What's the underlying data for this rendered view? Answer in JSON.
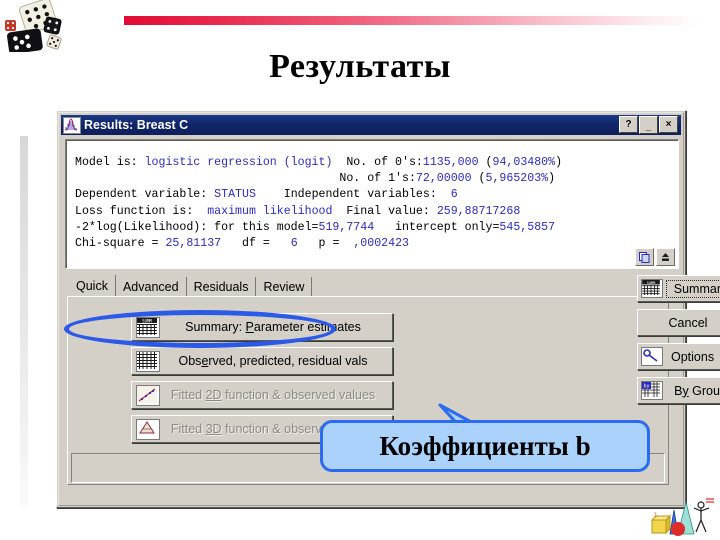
{
  "slide": {
    "title": "Результаты"
  },
  "decor": {
    "logo_icon": "dice-logo",
    "bar_color_start": "#e00b33",
    "bar_color_end": "#ffffff",
    "corner_icon": "geometry-shapes-clipart"
  },
  "dialog": {
    "titlebar": {
      "icon": "distribution-curve-icon",
      "title": "Results: Breast C",
      "help_label": "?",
      "minimize_label": "_",
      "close_label": "×"
    },
    "output": {
      "lines": [
        "Model is: logistic regression (logit)  No. of 0's:1135,000 (94,03480%)",
        "                                      No. of 1's:72,00000 (5,965203%)",
        "Dependent variable: STATUS    Independent variables:  6",
        "Loss function is:  maximum likelihood  Final value: 259,88717268",
        "-2*log(Likelihood): for this model=519,7744   intercept only=545,5857",
        "Chi-square = 25,81137   df =   6   p =  ,0002423"
      ],
      "stats": {
        "model": "logistic regression (logit)",
        "n_zeros": "1135,000",
        "pct_zeros": "94,03480%",
        "n_ones": "72,00000",
        "pct_ones": "5,965203%",
        "dependent_variable": "STATUS",
        "independent_variables": "6",
        "loss_function": "maximum likelihood",
        "final_value": "259,88717268",
        "neg2loglik_model": "519,7744",
        "neg2loglik_intercept_only": "545,5857",
        "chi_square": "25,81137",
        "df": "6",
        "p": ",0002423"
      },
      "tools": [
        {
          "name": "copy-icon",
          "glyph": "❐"
        },
        {
          "name": "send-to-top-icon",
          "glyph": "⬆"
        }
      ]
    },
    "tabs": [
      {
        "label": "Quick",
        "active": true
      },
      {
        "label": "Advanced",
        "active": false
      },
      {
        "label": "Residuals",
        "active": false
      },
      {
        "label": "Review",
        "active": false
      }
    ],
    "actions": [
      {
        "label_pre": "Summary: ",
        "label_accel": "P",
        "label_post": "arameter estimates",
        "icon": "summary-table-icon",
        "disabled": false
      },
      {
        "label_pre": "Obs",
        "label_accel": "e",
        "label_post": "rved, predicted, residual vals",
        "icon": "grid-table-icon",
        "disabled": false
      },
      {
        "label_pre": "Fitted ",
        "label_accel": "2D",
        "label_post": " function & observed values",
        "icon": "scatter-2d-icon",
        "disabled": true
      },
      {
        "label_pre": "Fitted ",
        "label_accel": "3D",
        "label_post": " function & observed values",
        "icon": "surface-3d-icon",
        "disabled": true
      }
    ],
    "side_buttons": [
      {
        "label": "Summary",
        "icon": "summary-table-icon",
        "focused": true,
        "caret": ""
      },
      {
        "label": "Cancel",
        "icon": "",
        "focused": false,
        "caret": ""
      },
      {
        "label": "Options",
        "icon": "options-key-icon",
        "focused": false,
        "caret": "▼"
      },
      {
        "label_pre": "By",
        "label_accel": "y",
        "label": "By Group",
        "icon": "by-group-icon",
        "focused": false,
        "caret": ""
      }
    ]
  },
  "annotations": {
    "ellipse_color": "#2b5ae8",
    "ellipse_target": "summary-parameter-estimates-button",
    "callout_text": "Коэффициенты b",
    "callout_fill": "#aad2fb",
    "callout_border": "#2b6bf0"
  }
}
